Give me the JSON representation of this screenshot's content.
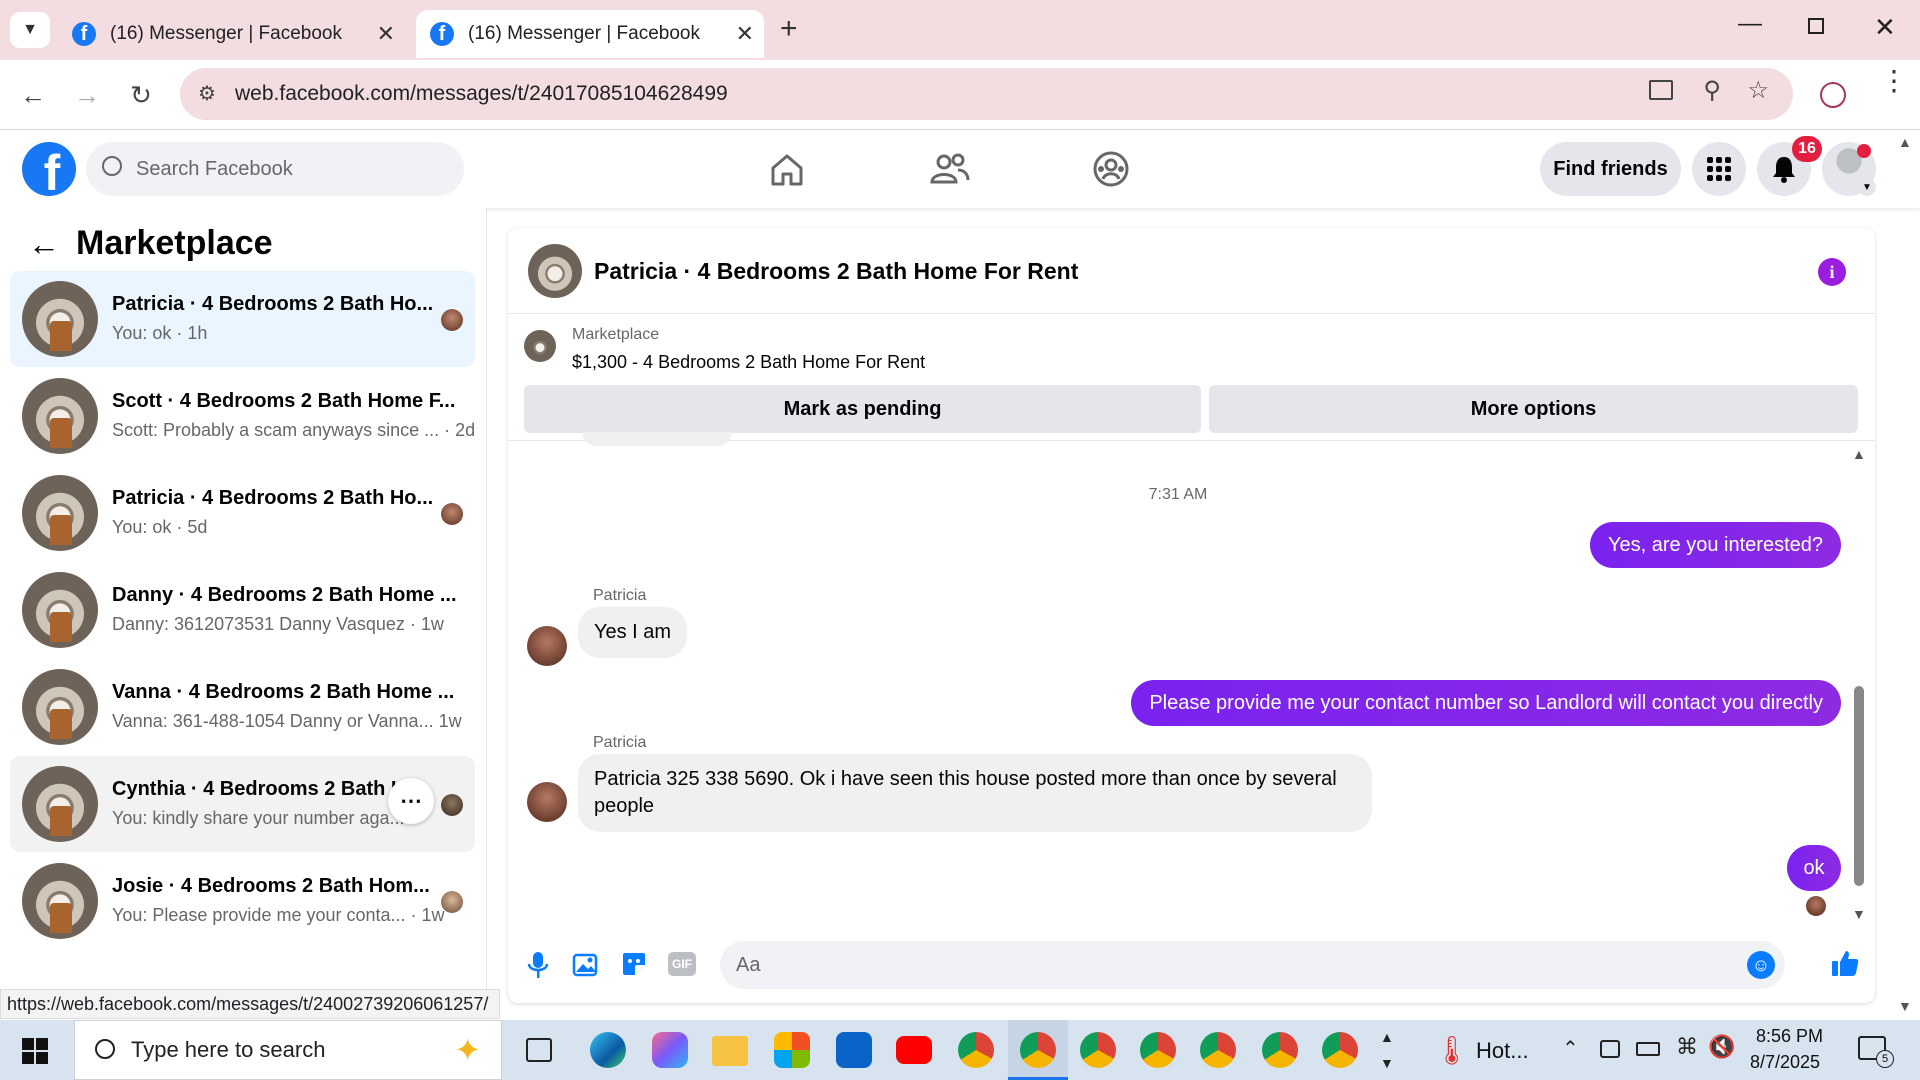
{
  "browser": {
    "tabs": [
      {
        "title": "(16) Messenger | Facebook"
      },
      {
        "title": "(16) Messenger | Facebook"
      }
    ],
    "url": "web.facebook.com/messages/t/24017085104628499",
    "status_url": "https://web.facebook.com/messages/t/24002739206061257/"
  },
  "facebook": {
    "search_placeholder": "Search Facebook",
    "find_friends": "Find friends",
    "notification_count": "16"
  },
  "sidebar": {
    "title": "Marketplace",
    "conversations": [
      {
        "title": "Patricia · 4 Bedrooms 2 Bath Ho...",
        "preview": "You: ok · 1h"
      },
      {
        "title": "Scott · 4 Bedrooms 2 Bath Home F...",
        "preview": "Scott: Probably a scam anyways since ... · 2d"
      },
      {
        "title": "Patricia · 4 Bedrooms 2 Bath Ho...",
        "preview": "You: ok · 5d"
      },
      {
        "title": "Danny · 4 Bedrooms 2 Bath Home ...",
        "preview": "Danny: 3612073531 Danny Vasquez · 1w"
      },
      {
        "title": "Vanna · 4 Bedrooms 2 Bath Home ...",
        "preview": "Vanna: 361-488-1054 Danny or Vanna...  1w"
      },
      {
        "title": "Cynthia · 4 Bedrooms 2 Bath H",
        "preview": "You: kindly share your number aga..."
      },
      {
        "title": "Josie · 4 Bedrooms 2 Bath Hom...",
        "preview": "You: Please provide me your conta... · 1w"
      }
    ]
  },
  "chat": {
    "header_title": "Patricia · 4 Bedrooms 2 Bath Home For Rent",
    "listing_label": "Marketplace",
    "listing_title": "$1,300 - 4 Bedrooms 2 Bath Home For Rent",
    "mark_pending": "Mark as pending",
    "more_options": "More options",
    "timestamp": "7:31 AM",
    "messages": [
      {
        "from": "me",
        "text": "Yes, are you interested?"
      },
      {
        "from": "Patricia",
        "sender": "Patricia",
        "text": "Yes I am"
      },
      {
        "from": "me",
        "text": "Please provide me your contact number so Landlord will contact you directly"
      },
      {
        "from": "Patricia",
        "sender": "Patricia",
        "text": "Patricia 325 338 5690.  Ok  i have seen this house posted more than once by several people"
      },
      {
        "from": "me",
        "text": "ok"
      }
    ],
    "composer_placeholder": "Aa",
    "gif_label": "GIF"
  },
  "taskbar": {
    "search_placeholder": "Type here to search",
    "weather": "Hot...",
    "time": "8:56 PM",
    "date": "8/7/2025",
    "notif_count": "5"
  },
  "colors": {
    "fb_blue": "#1877f2",
    "message_purple": "#8a2be2",
    "notification_red": "#e41e3f"
  }
}
